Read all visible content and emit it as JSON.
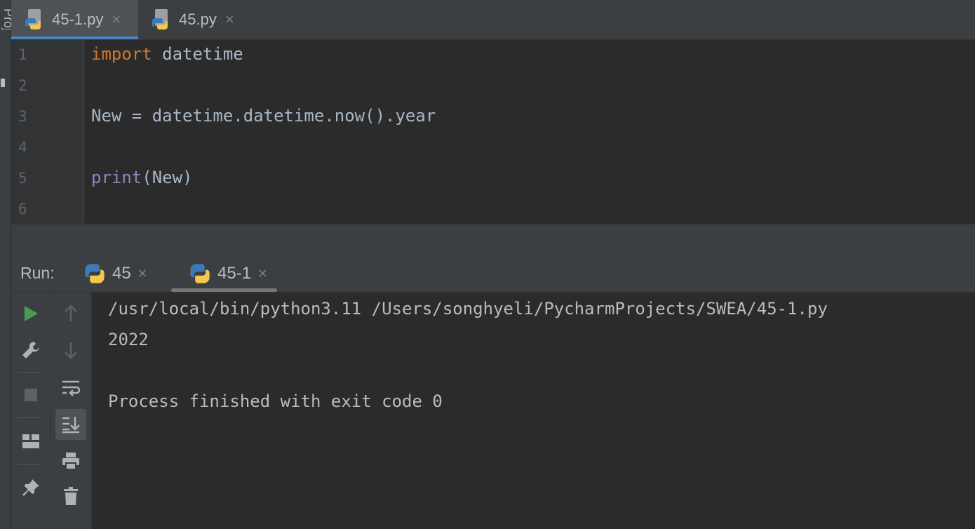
{
  "left_strip": {
    "label": "Project"
  },
  "editor_tabs": [
    {
      "label": "45-1.py",
      "active": true,
      "icon": "python-file-icon",
      "close": "×"
    },
    {
      "label": "45.py",
      "active": false,
      "icon": "python-file-icon",
      "close": "×"
    }
  ],
  "editor": {
    "line_numbers": [
      "1",
      "2",
      "3",
      "4",
      "5",
      "6"
    ],
    "lines": {
      "l1_kw": "import",
      "l1_rest": " datetime",
      "l3": "New = datetime.datetime.now().year",
      "l5_fn": "print",
      "l5_rest": "(New)"
    }
  },
  "run_panel": {
    "label": "Run:",
    "tabs": [
      {
        "label": "45",
        "active": false,
        "close": "×"
      },
      {
        "label": "45-1",
        "active": true,
        "close": "×"
      }
    ],
    "toolbar_left": [
      "rerun-icon",
      "wrench-icon",
      "stop-icon",
      "layout-icon",
      "pin-icon"
    ],
    "toolbar_right": [
      "arrow-up-icon",
      "arrow-down-icon",
      "soft-wrap-icon",
      "scroll-to-end-icon",
      "print-icon",
      "trash-icon"
    ]
  },
  "console": {
    "lines": [
      "/usr/local/bin/python3.11 /Users/songhyeli/PycharmProjects/SWEA/45-1.py",
      "2022",
      "",
      "Process finished with exit code 0"
    ]
  },
  "colors": {
    "accent": "#4a88c7",
    "keyword": "#cc7832",
    "builtin": "#8888c6",
    "run_green": "#499c54"
  }
}
